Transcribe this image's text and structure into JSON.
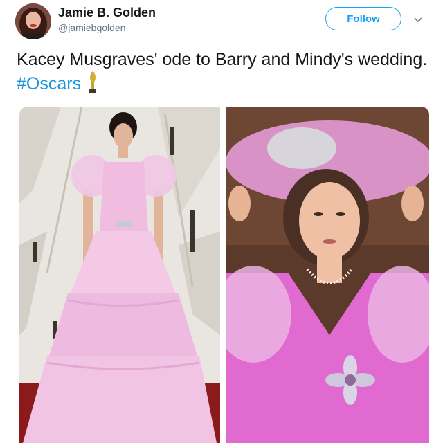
{
  "author": {
    "name": "Jamie B. Golden",
    "handle": "@jamiebgolden"
  },
  "follow_label": "Follow",
  "tweet": {
    "text": "Kacey Musgraves' ode to Barry and Mindy's wedding.",
    "hashtag": "#Oscars"
  },
  "icons": {
    "menu": "chevron-down-icon",
    "emoji": "trophy-icon"
  },
  "colors": {
    "accent": "#1da1f2",
    "hashtag": "#1b95e0",
    "text": "#14171a",
    "secondary": "#657786"
  }
}
